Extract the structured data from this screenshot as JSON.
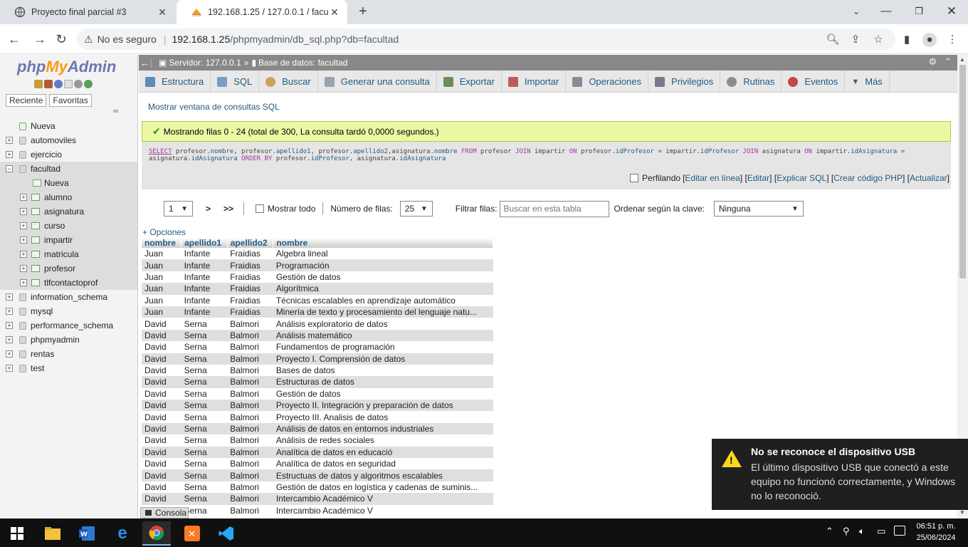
{
  "browser": {
    "tabs": [
      {
        "title": "Proyecto final parcial #3",
        "active": false
      },
      {
        "title": "192.168.1.25 / 127.0.0.1 / facultad | phpMyAdmin",
        "active": true
      }
    ],
    "security_label": "No es seguro",
    "url_host": "192.168.1.25",
    "url_path": "/phpmyadmin/db_sql.php?db=facultad"
  },
  "sidebar": {
    "logo_php": "php",
    "logo_my": "My",
    "logo_admin": "Admin",
    "tabs": [
      "Reciente",
      "Favoritas"
    ],
    "tree": [
      {
        "label": "Nueva",
        "level": 0,
        "kind": "new"
      },
      {
        "label": "automoviles",
        "level": 0,
        "kind": "db"
      },
      {
        "label": "ejercicio",
        "level": 0,
        "kind": "db"
      },
      {
        "label": "facultad",
        "level": 0,
        "kind": "db",
        "expanded": true
      },
      {
        "label": "Nueva",
        "level": 1,
        "kind": "new"
      },
      {
        "label": "alumno",
        "level": 1,
        "kind": "table"
      },
      {
        "label": "asignatura",
        "level": 1,
        "kind": "table"
      },
      {
        "label": "curso",
        "level": 1,
        "kind": "table"
      },
      {
        "label": "impartir",
        "level": 1,
        "kind": "table"
      },
      {
        "label": "matricula",
        "level": 1,
        "kind": "table"
      },
      {
        "label": "profesor",
        "level": 1,
        "kind": "table"
      },
      {
        "label": "tlfcontactoprof",
        "level": 1,
        "kind": "table"
      },
      {
        "label": "information_schema",
        "level": 0,
        "kind": "db"
      },
      {
        "label": "mysql",
        "level": 0,
        "kind": "db"
      },
      {
        "label": "performance_schema",
        "level": 0,
        "kind": "db"
      },
      {
        "label": "phpmyadmin",
        "level": 0,
        "kind": "db"
      },
      {
        "label": "rentas",
        "level": 0,
        "kind": "db"
      },
      {
        "label": "test",
        "level": 0,
        "kind": "db"
      }
    ]
  },
  "breadcrumb": {
    "server": "Servidor: 127.0.0.1",
    "separator": "»",
    "database": "Base de datos: facultad"
  },
  "main_tabs": [
    {
      "label": "Estructura",
      "color": "#5b8db8"
    },
    {
      "label": "SQL",
      "color": "#7a9cc6"
    },
    {
      "label": "Buscar",
      "color": "#c9a45c"
    },
    {
      "label": "Generar una consulta",
      "color": "#9aa4b0"
    },
    {
      "label": "Exportar",
      "color": "#6a8f5a"
    },
    {
      "label": "Importar",
      "color": "#c05a5a"
    },
    {
      "label": "Operaciones",
      "color": "#8a8a9a"
    },
    {
      "label": "Privilegios",
      "color": "#7a7a8a"
    },
    {
      "label": "Rutinas",
      "color": "#8c8c8c"
    },
    {
      "label": "Eventos",
      "color": "#c04a4a"
    },
    {
      "label": "Más",
      "color": "#555555"
    }
  ],
  "sql_window_link": "Mostrar ventana de consultas SQL",
  "success_message": "Mostrando filas 0 - 24 (total de 300, La consulta tardó 0,0000 segundos.)",
  "sql": {
    "t1": "SELECT",
    "t2": " profesor.",
    "t3": "nombre",
    "t4": ", profesor.",
    "t5": "apellido1",
    "t6": ", profesor.",
    "t7": "apellido2",
    "t8": ",asignatura.",
    "t9": "nombre",
    "t10": " FROM",
    "t11": " profesor ",
    "t12": "JOIN",
    "t13": " impartir ",
    "t14": "ON",
    "t15": " profesor.",
    "t16": "idProfesor",
    "t17": " = impartir.",
    "t18": "idProfesor",
    "t19": " JOIN",
    "t20": " asignatura ",
    "t21": "ON",
    "t22": " impartir.",
    "t23": "idAsignatura",
    "t24": " = asignatura.",
    "t25": "idAsignatura",
    "t26": " ORDER BY",
    "t27": " profesor.",
    "t28": "idProfesor",
    "t29": ", asignatura.",
    "t30": "idAsignatura"
  },
  "profiling": {
    "label": "Perfilando",
    "links": [
      "Editar en línea",
      "Editar",
      "Explicar SQL",
      "Crear código PHP",
      "Actualizar"
    ]
  },
  "navigation": {
    "page": "1",
    "next": ">",
    "last": ">>",
    "show_all": "Mostrar todo",
    "rows_label": "Número de filas:",
    "rows_value": "25",
    "filter_label": "Filtrar filas:",
    "filter_placeholder": "Buscar en esta tabla",
    "sort_label": "Ordenar según la clave:",
    "sort_value": "Ninguna"
  },
  "options_link": "+ Opciones",
  "table": {
    "columns": [
      "nombre",
      "apellido1",
      "apellido2",
      "nombre"
    ],
    "rows": [
      [
        "Juan",
        "Infante",
        "Fraidias",
        "Algebra lineal"
      ],
      [
        "Juan",
        "Infante",
        "Fraidias",
        "Programación"
      ],
      [
        "Juan",
        "Infante",
        "Fraidias",
        "Gestión de datos"
      ],
      [
        "Juan",
        "Infante",
        "Fraidias",
        "Algorítmica"
      ],
      [
        "Juan",
        "Infante",
        "Fraidias",
        "Técnicas escalables en aprendizaje automático"
      ],
      [
        "Juan",
        "Infante",
        "Fraidias",
        "Minería de texto y procesamiento del lenguaje natu..."
      ],
      [
        "David",
        "Serna",
        "Balmori",
        "Análisis exploratorio de datos"
      ],
      [
        "David",
        "Serna",
        "Balmori",
        "Análisis matemático"
      ],
      [
        "David",
        "Serna",
        "Balmori",
        "Fundamentos de programación"
      ],
      [
        "David",
        "Serna",
        "Balmori",
        "Proyecto I. Comprensión de datos"
      ],
      [
        "David",
        "Serna",
        "Balmori",
        "Bases de datos"
      ],
      [
        "David",
        "Serna",
        "Balmori",
        "Estructuras de datos"
      ],
      [
        "David",
        "Serna",
        "Balmori",
        "Gestión de datos"
      ],
      [
        "David",
        "Serna",
        "Balmori",
        "Proyecto II. Integración y preparación de datos"
      ],
      [
        "David",
        "Serna",
        "Balmori",
        "Proyecto III. Analisis de datos"
      ],
      [
        "David",
        "Serna",
        "Balmori",
        "Análisis de datos en entornos industriales"
      ],
      [
        "David",
        "Serna",
        "Balmori",
        "Análisis de redes sociales"
      ],
      [
        "David",
        "Serna",
        "Balmori",
        "Analítica de datos en educació"
      ],
      [
        "David",
        "Serna",
        "Balmori",
        "Analítica de datos en seguridad"
      ],
      [
        "David",
        "Serna",
        "Balmori",
        "Estructuas de datos y algoritmos escalables"
      ],
      [
        "David",
        "Serna",
        "Balmori",
        "Gestión de datos en logística y cadenas de suminis..."
      ],
      [
        "David",
        "Serna",
        "Balmori",
        "Intercambio Académico V"
      ],
      [
        "David",
        "Serna",
        "Balmori",
        "Intercambio Académico V"
      ]
    ]
  },
  "console_label": "Consola",
  "toast": {
    "title": "No se reconoce el dispositivo USB",
    "message": "El último dispositivo USB que conectó a este equipo no funcionó correctamente, y Windows no lo reconoció."
  },
  "clock": {
    "time": "06:51 p. m.",
    "date": "25/06/2024"
  }
}
